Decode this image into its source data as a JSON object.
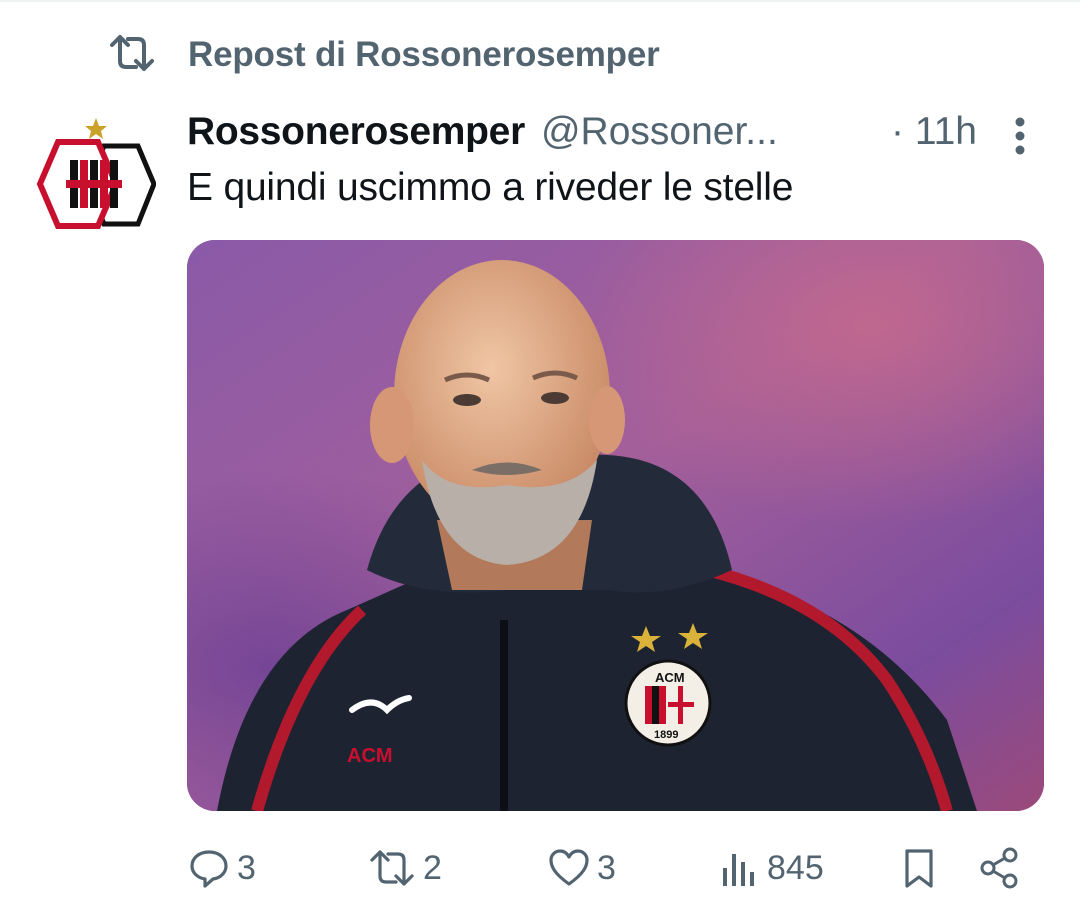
{
  "repost": {
    "icon": "repost-icon",
    "label": "Repost di Rossonerosemper"
  },
  "post": {
    "display_name": "Rossonerosemper",
    "handle": "@Rossoner...",
    "time": "· 11h",
    "text": "E quindi uscimmo a riveder le stelle",
    "avatar_icon": "milan-crest-avatar",
    "media": {
      "description_icon": "coach-photo",
      "jacket_brand": "ACM",
      "crest_top": "ACM",
      "crest_year": "1899"
    }
  },
  "actions": {
    "reply_count": "3",
    "repost_count": "2",
    "like_count": "3",
    "views_count": "845"
  },
  "colors": {
    "muted": "#536471",
    "text": "#0f1419",
    "milan_red": "#c8102e"
  }
}
